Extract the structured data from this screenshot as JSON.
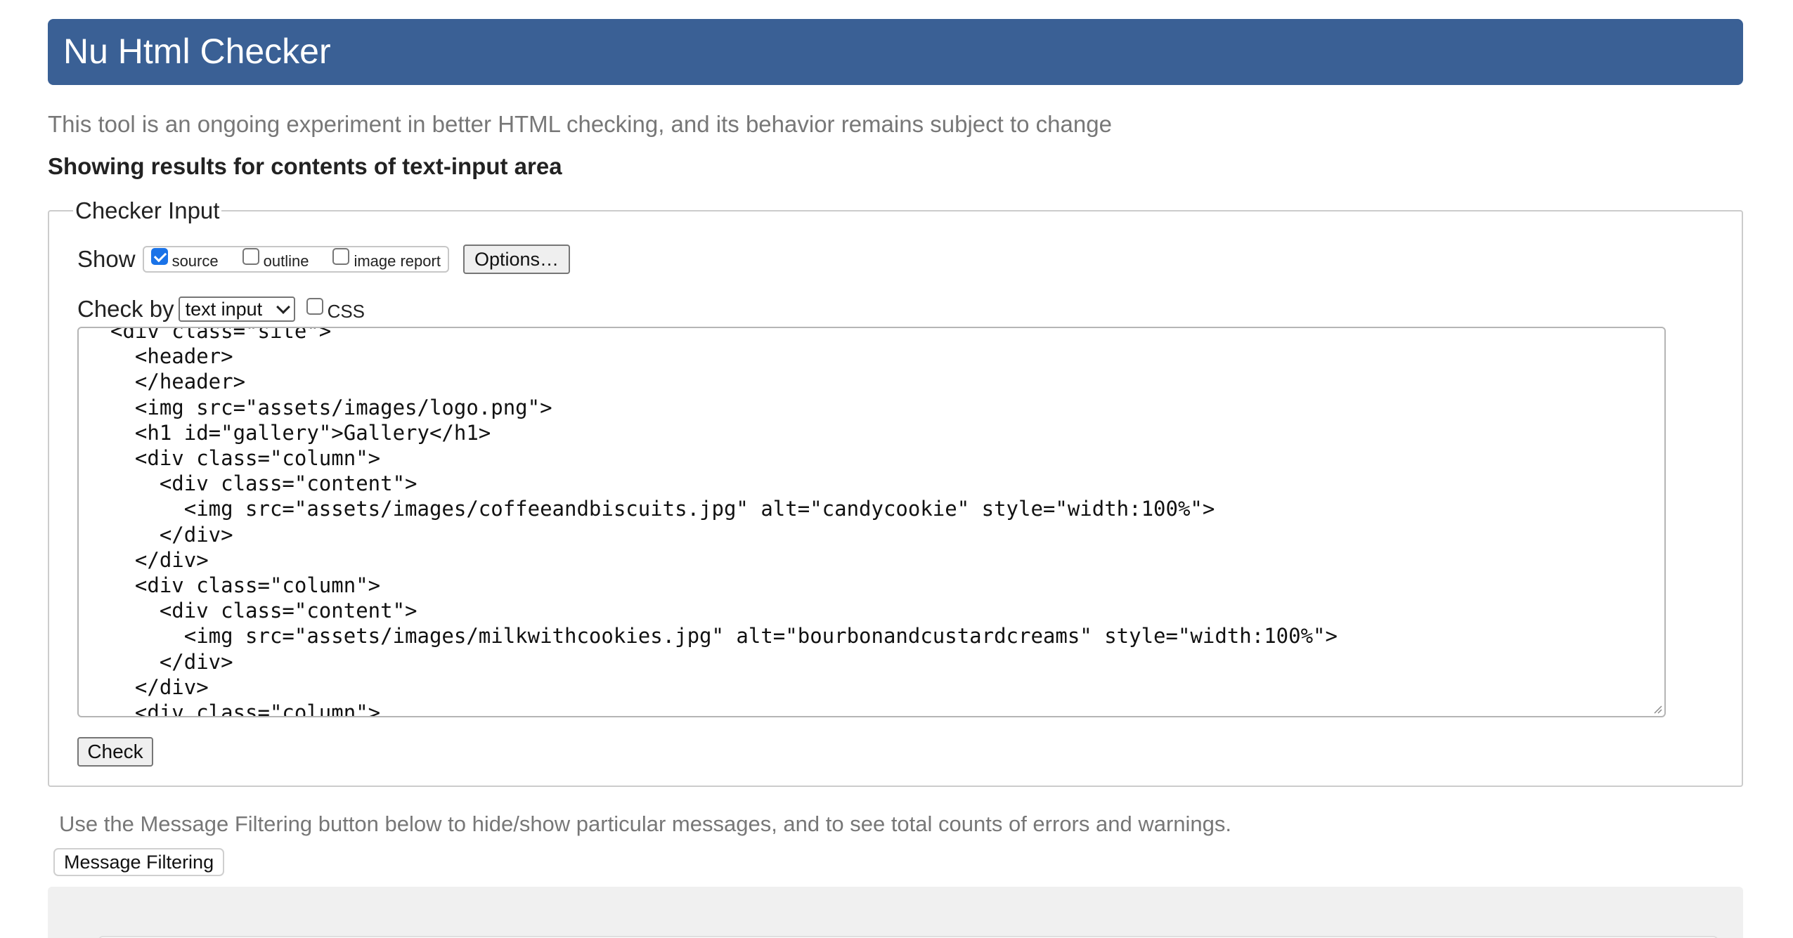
{
  "header": {
    "title": "Nu Html Checker",
    "color": "#3a6095"
  },
  "tagline": "This tool is an ongoing experiment in better HTML checking, and its behavior remains subject to change",
  "results_heading": "Showing results for contents of text-input area",
  "checker": {
    "legend": "Checker Input",
    "show_label": "Show",
    "show_options": [
      {
        "label": "source",
        "checked": true
      },
      {
        "label": "outline",
        "checked": false
      },
      {
        "label": "image report",
        "checked": false
      }
    ],
    "options_button": "Options…",
    "check_by_label": "Check by",
    "check_by_selected": "text input",
    "css_label": "CSS",
    "css_checked": false,
    "source_lines": [
      "<div class=\"site\">",
      "  <header>",
      "  </header>",
      "  <img src=\"assets/images/logo.png\">",
      "  <h1 id=\"gallery\">Gallery</h1>",
      "  <div class=\"column\">",
      "    <div class=\"content\">",
      "      <img src=\"assets/images/coffeeandbiscuits.jpg\" alt=\"candycookie\" style=\"width:100%\">",
      "    </div>",
      "  </div>",
      "  <div class=\"column\">",
      "    <div class=\"content\">",
      "      <img src=\"assets/images/milkwithcookies.jpg\" alt=\"bourbonandcustardcreams\" style=\"width:100%\">",
      "    </div>",
      "  </div>",
      "  <div class=\"column\">"
    ],
    "check_button": "Check"
  },
  "filter_hint": "Use the Message Filtering button below to hide/show particular messages, and to see total counts of errors and warnings.",
  "filter_button": "Message Filtering",
  "accent_colors": {
    "checkbox_checked": "#1a73e8",
    "muted_text": "#777777"
  }
}
